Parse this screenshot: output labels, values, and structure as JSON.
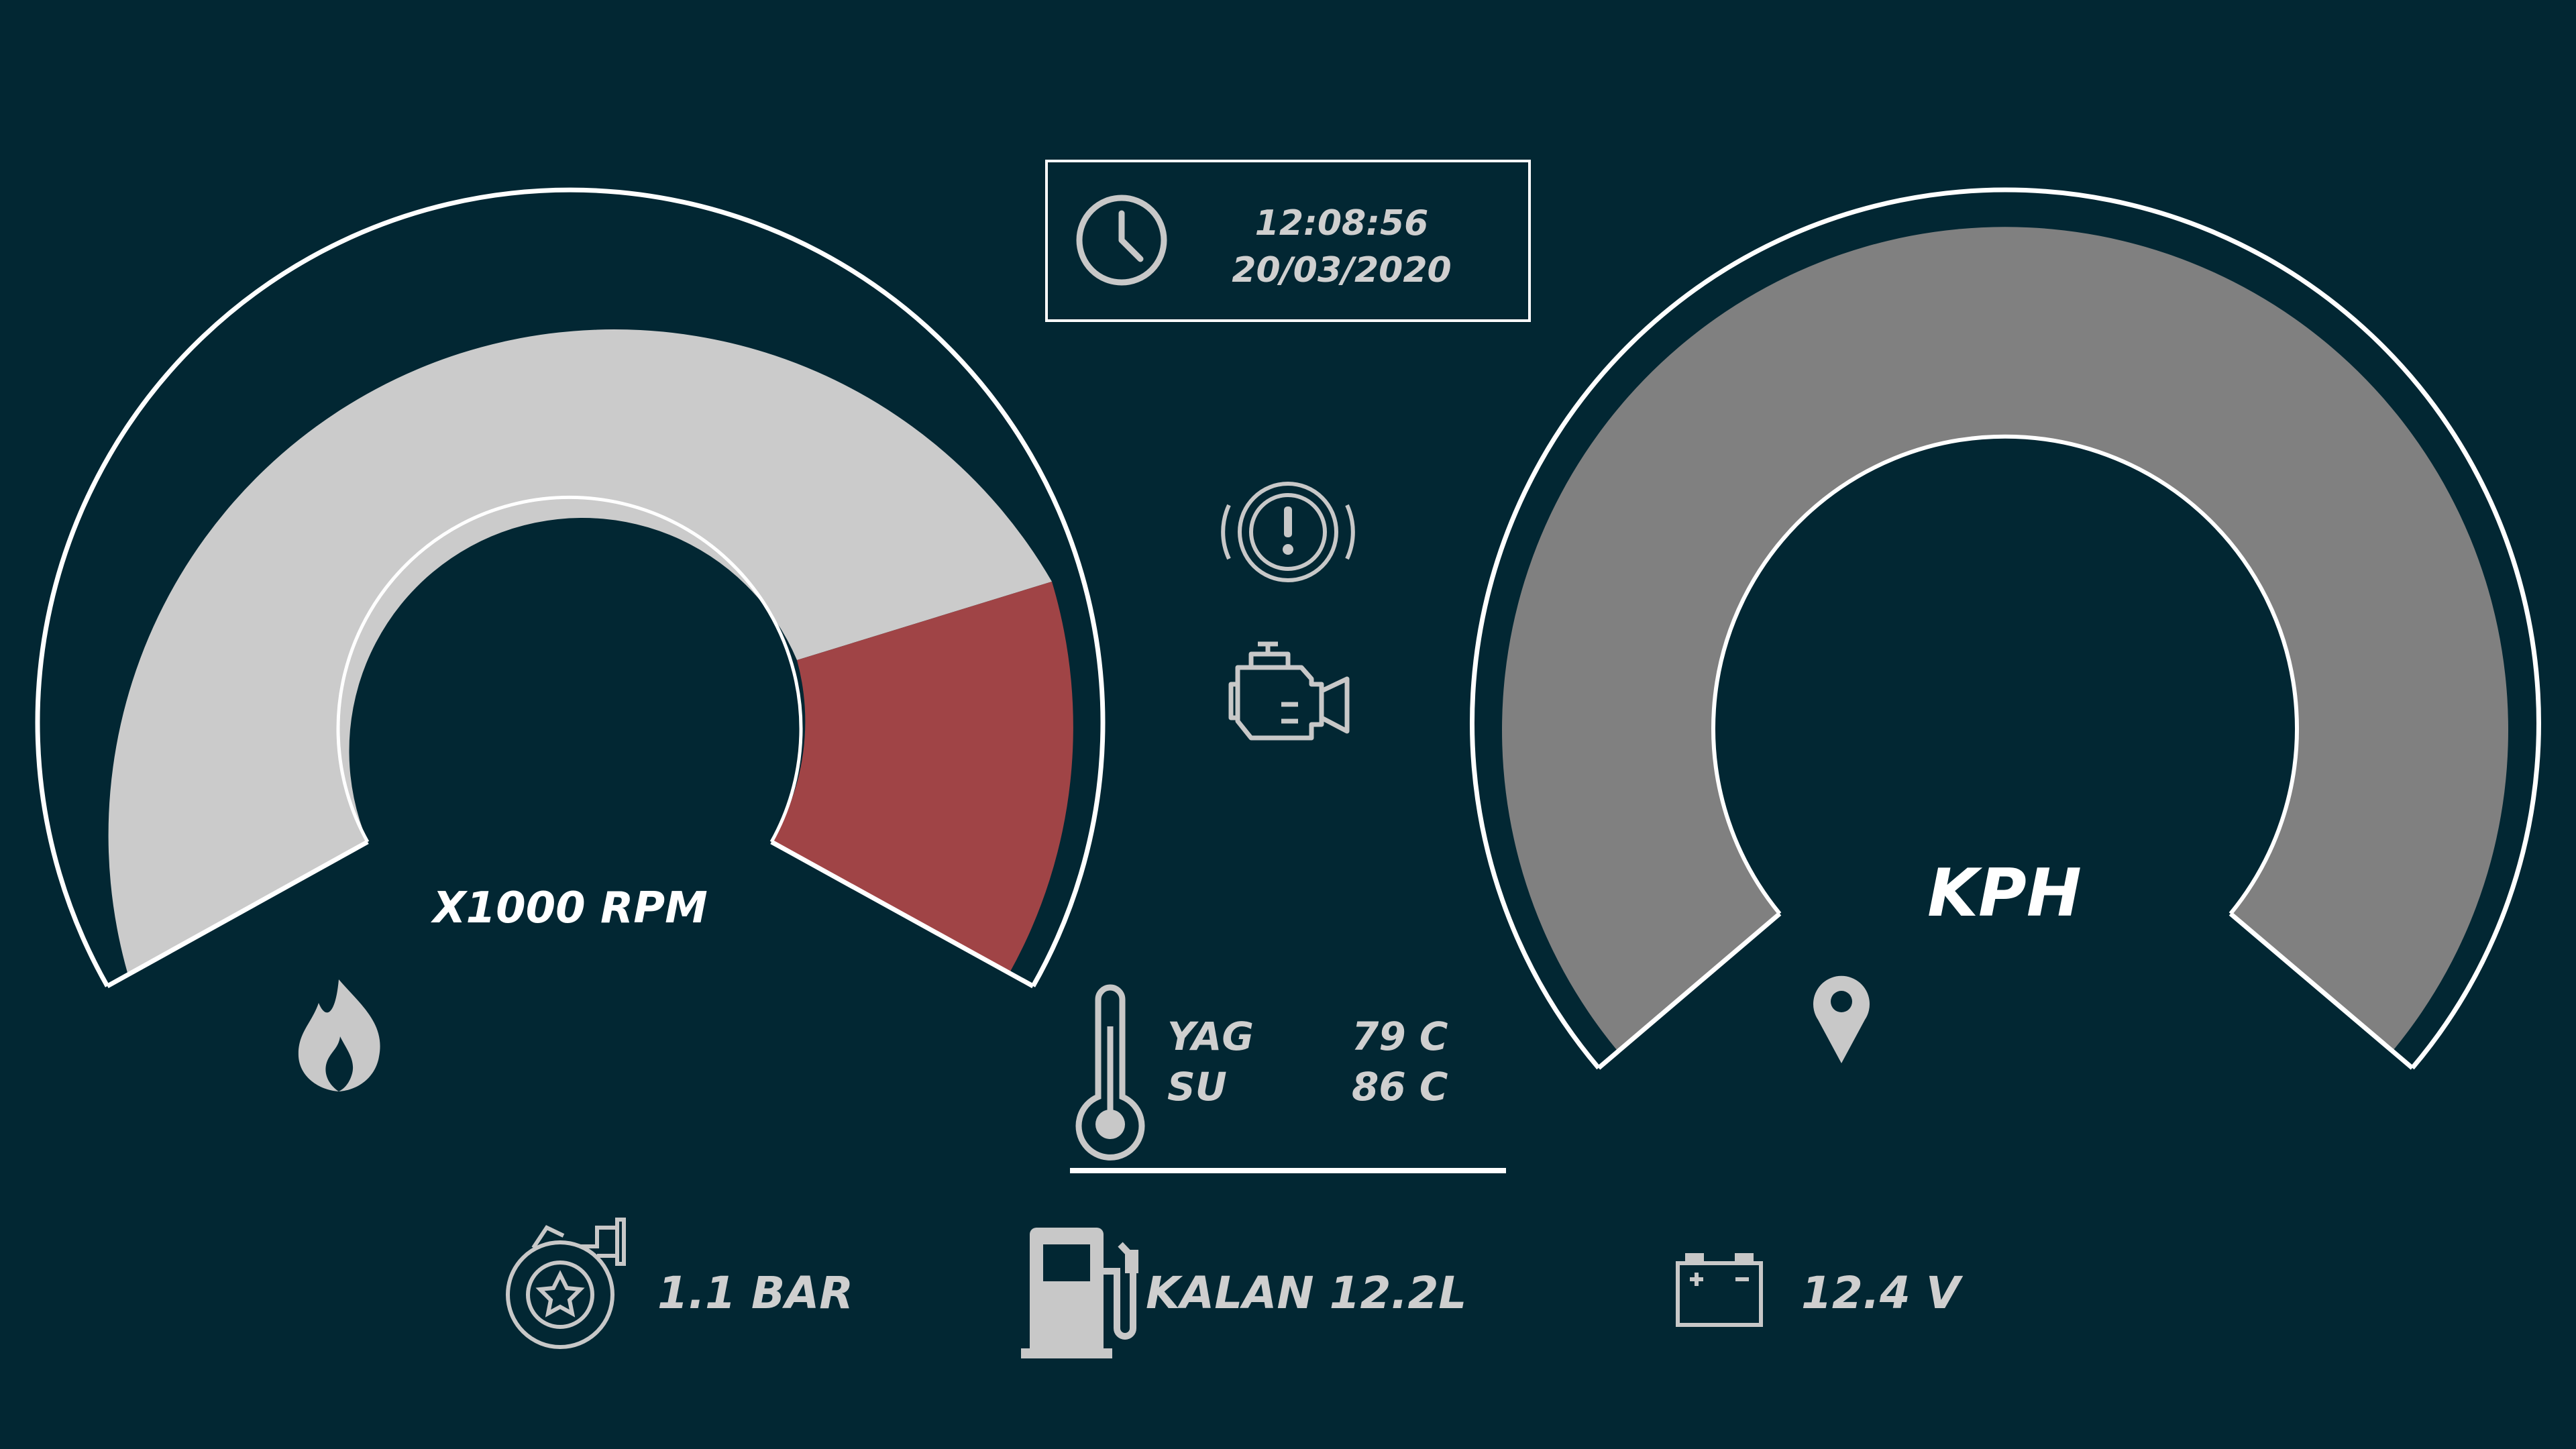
{
  "theme": {
    "background": "#022733",
    "outline": "#ffffff",
    "text": "#cfcfcf",
    "rpm_fill": "#cbcbcb",
    "rpm_redline": "#a04446",
    "kph_fill": "#808080",
    "icon": "#c8c8c8"
  },
  "clock": {
    "time": "12:08:56",
    "date": "20/03/2020",
    "icon": "clock-icon"
  },
  "rpm_gauge": {
    "label": "X1000 RPM",
    "redline_fraction": 0.32,
    "icon": "flame-icon"
  },
  "kph_gauge": {
    "label": "KPH",
    "icon": "location-pin-icon"
  },
  "warnings": [
    {
      "icon": "brake-warning-icon"
    },
    {
      "icon": "check-engine-icon"
    }
  ],
  "temperatures": {
    "icon": "thermometer-icon",
    "rows": [
      {
        "label": "YAG",
        "value": "79 C"
      },
      {
        "label": "SU",
        "value": "86 C"
      }
    ]
  },
  "bottom": {
    "boost": {
      "icon": "turbo-icon",
      "text": "1.1 BAR"
    },
    "fuel": {
      "icon": "fuel-pump-icon",
      "text": "KALAN 12.2L"
    },
    "battery": {
      "icon": "battery-icon",
      "text": "12.4 V"
    }
  }
}
